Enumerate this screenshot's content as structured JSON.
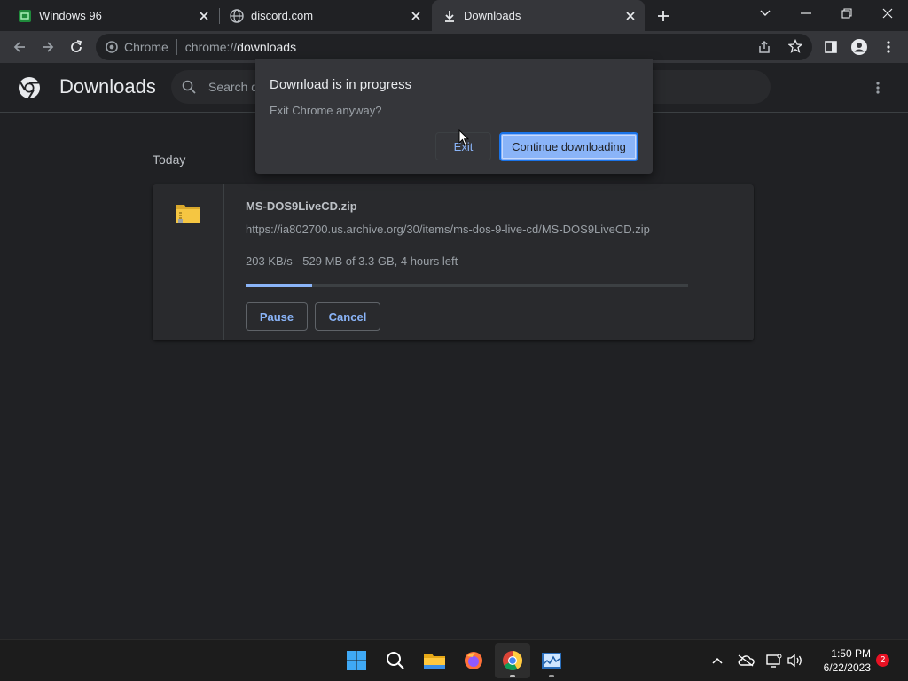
{
  "tabs": [
    {
      "title": "Windows 96",
      "favicon": "windows96-icon"
    },
    {
      "title": "discord.com",
      "favicon": "globe-icon"
    },
    {
      "title": "Downloads",
      "favicon": "download-icon",
      "active": true
    }
  ],
  "omnibox": {
    "site_label": "Chrome",
    "scheme": "chrome://",
    "host": "downloads"
  },
  "downloads_page": {
    "title": "Downloads",
    "search_placeholder": "Search downloads",
    "section": "Today",
    "item": {
      "filename": "MS-DOS9LiveCD.zip",
      "url": "https://ia802700.us.archive.org/30/items/ms-dos-9-live-cd/MS-DOS9LiveCD.zip",
      "status": "203 KB/s - 529 MB of 3.3 GB, 4 hours left",
      "progress_fraction": 0.15,
      "pause_label": "Pause",
      "cancel_label": "Cancel"
    }
  },
  "dialog": {
    "title": "Download is in progress",
    "message": "Exit Chrome anyway?",
    "exit_label": "Exit",
    "continue_label": "Continue downloading"
  },
  "taskbar": {
    "time": "1:50 PM",
    "date": "6/22/2023",
    "notification_count": "2"
  },
  "colors": {
    "accent": "#8ab4f8",
    "background": "#202124",
    "toolbar": "#35363a"
  }
}
